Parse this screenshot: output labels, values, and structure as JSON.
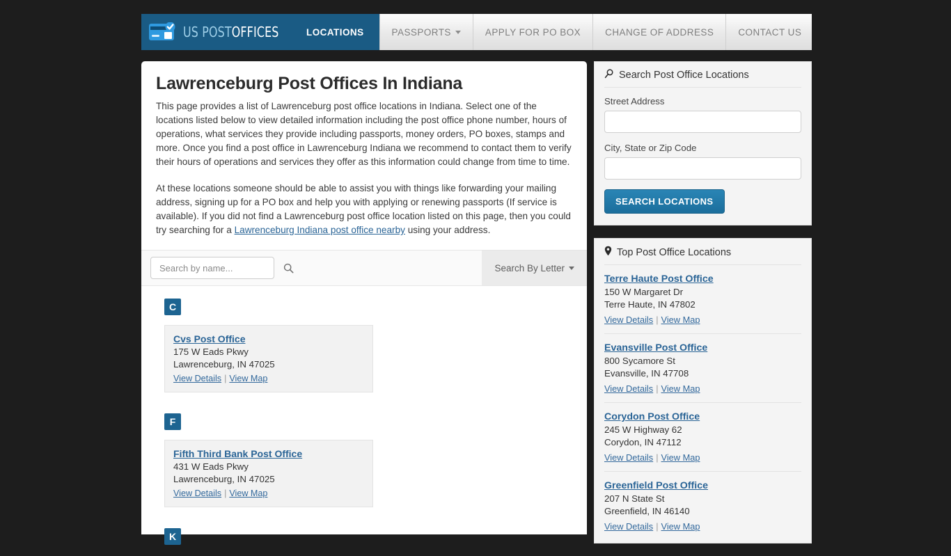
{
  "header": {
    "logo": {
      "icon": "mail-card-check-icon",
      "text_primary": "US POST",
      "text_secondary": "OFFICES"
    },
    "nav": [
      {
        "label": "LOCATIONS",
        "active": true,
        "caret": false
      },
      {
        "label": "PASSPORTS",
        "active": false,
        "caret": true
      },
      {
        "label": "APPLY FOR PO BOX",
        "active": false,
        "caret": false
      },
      {
        "label": "CHANGE OF ADDRESS",
        "active": false,
        "caret": false
      },
      {
        "label": "CONTACT US",
        "active": false,
        "caret": false
      }
    ]
  },
  "main": {
    "title": "Lawrenceburg Post Offices In Indiana",
    "paragraph_1": "This page provides a list of Lawrenceburg post office locations in Indiana. Select one of the locations listed below to view detailed information including the post office phone number, hours of operations, what services they provide including passports, money orders, PO boxes, stamps and more. Once you find a post office in Lawrenceburg Indiana we recommend to contact them to verify their hours of operations and services they offer as this information could change from time to time.",
    "paragraph_2_a": "At these locations someone should be able to assist you with things like forwarding your mailing address, signing up for a PO box and help you with applying or renewing passports (If service is available). If you did not find a Lawrenceburg post office location listed on this page, then you could try searching for a ",
    "paragraph_2_link": "Lawrenceburg Indiana post office nearby",
    "paragraph_2_b": " using your address.",
    "search_by_name_placeholder": "Search by name...",
    "search_by_name_value": "",
    "search_by_letter_label": "Search By Letter",
    "groups": [
      {
        "letter": "C",
        "offices": [
          {
            "name": "Cvs Post Office",
            "street": "175 W Eads Pkwy",
            "citystatezip": "Lawrenceburg, IN 47025",
            "view_details": "View Details",
            "view_map": "View Map"
          }
        ]
      },
      {
        "letter": "F",
        "offices": [
          {
            "name": "Fifth Third Bank Post Office",
            "street": "431 W Eads Pkwy",
            "citystatezip": "Lawrenceburg, IN 47025",
            "view_details": "View Details",
            "view_map": "View Map"
          }
        ]
      },
      {
        "letter": "K",
        "offices": []
      }
    ]
  },
  "sidebar": {
    "search_panel": {
      "title": "Search Post Office Locations",
      "street_label": "Street Address",
      "street_value": "",
      "city_label": "City, State or Zip Code",
      "city_value": "",
      "button_label": "SEARCH LOCATIONS"
    },
    "top_panel": {
      "title": "Top Post Office Locations",
      "items": [
        {
          "name": "Terre Haute Post Office",
          "street": "150 W Margaret Dr",
          "citystatezip": "Terre Haute, IN 47802",
          "view_details": "View Details",
          "view_map": "View Map"
        },
        {
          "name": "Evansville Post Office",
          "street": "800 Sycamore St",
          "citystatezip": "Evansville, IN 47708",
          "view_details": "View Details",
          "view_map": "View Map"
        },
        {
          "name": "Corydon Post Office",
          "street": "245 W Highway 62",
          "citystatezip": "Corydon, IN 47112",
          "view_details": "View Details",
          "view_map": "View Map"
        },
        {
          "name": "Greenfield Post Office",
          "street": "207 N State St",
          "citystatezip": "Greenfield, IN 46140",
          "view_details": "View Details",
          "view_map": "View Map"
        }
      ]
    }
  },
  "colors": {
    "brand_blue": "#1a5b84",
    "link_blue": "#2a6496",
    "page_background": "#1d1d1d",
    "badge_blue": "#1d6491"
  }
}
